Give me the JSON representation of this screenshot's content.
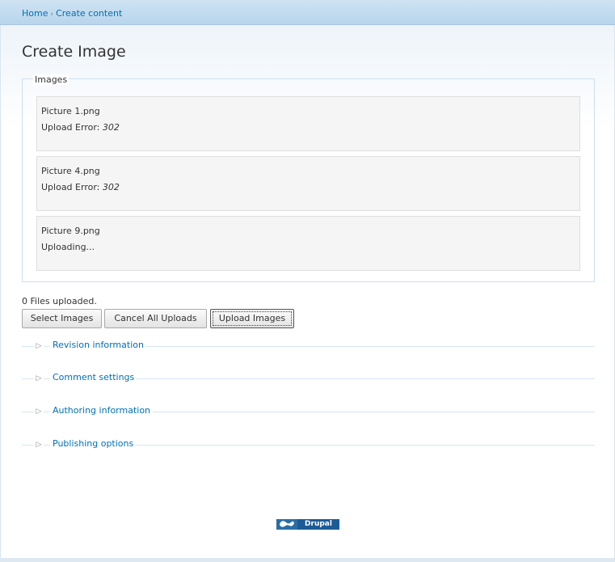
{
  "breadcrumb": {
    "items": [
      "Home",
      "Create content"
    ],
    "separator": "›"
  },
  "page": {
    "title": "Create Image"
  },
  "images_fieldset": {
    "legend": "Images",
    "files": [
      {
        "name": "Picture 1.png",
        "status_label": "Upload Error: ",
        "status_code": "302"
      },
      {
        "name": "Picture 4.png",
        "status_label": "Upload Error: ",
        "status_code": "302"
      },
      {
        "name": "Picture 9.png",
        "status_label": "Uploading...",
        "status_code": ""
      }
    ]
  },
  "upload": {
    "count_text": "0 Files uploaded.",
    "select_label": "Select Images",
    "cancel_label": "Cancel All Uploads",
    "upload_label": "Upload Images"
  },
  "sections": [
    {
      "label": "Revision information",
      "icon": "triangle-right-icon"
    },
    {
      "label": "Comment settings",
      "icon": "triangle-right-icon"
    },
    {
      "label": "Authoring information",
      "icon": "triangle-right-icon"
    },
    {
      "label": "Publishing options",
      "icon": "triangle-right-icon"
    }
  ],
  "footer": {
    "badge_text": "Drupal",
    "badge_icon": "drupal-drop-icon"
  },
  "colors": {
    "link": "#0071b3",
    "header_bar": "#b8d5ec",
    "panel": "#f5f5f5"
  }
}
